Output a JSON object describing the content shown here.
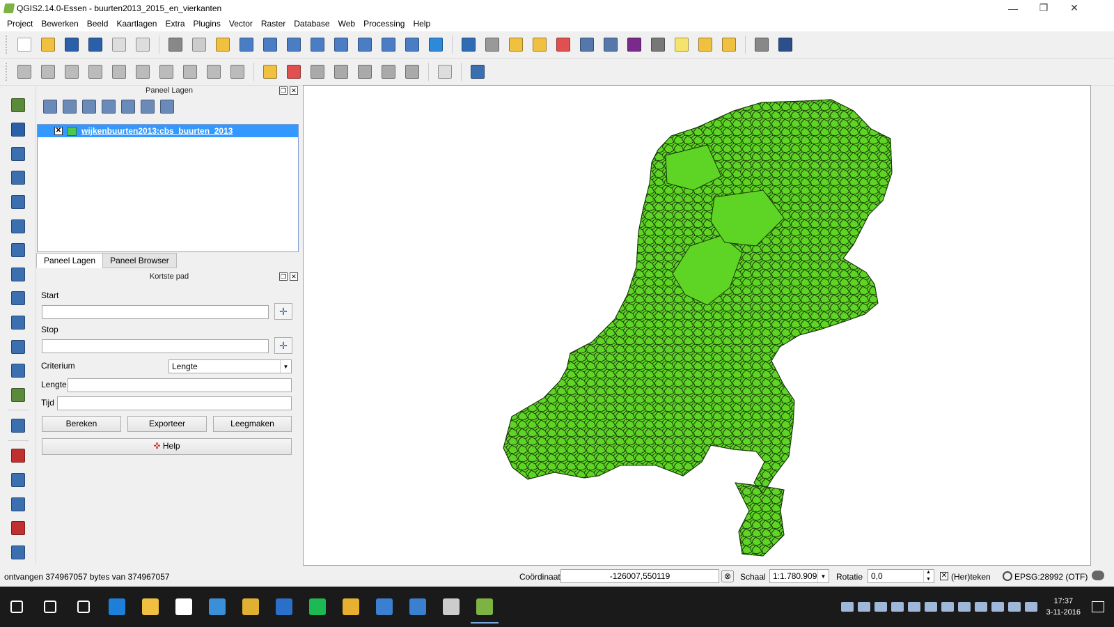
{
  "window": {
    "title": "QGIS2.14.0-Essen - buurten2013_2015_en_vierkanten",
    "min": "—",
    "max": "❐",
    "close": "✕"
  },
  "menu": [
    "Project",
    "Bewerken",
    "Beeld",
    "Kaartlagen",
    "Extra",
    "Plugins",
    "Vector",
    "Raster",
    "Database",
    "Web",
    "Processing",
    "Help"
  ],
  "toolbar1": [
    {
      "icon": "new-project-icon",
      "color": "#ffffff"
    },
    {
      "icon": "open-project-icon",
      "color": "#f0c040"
    },
    {
      "icon": "save-project-icon",
      "color": "#2b5fa8"
    },
    {
      "icon": "save-as-icon",
      "color": "#2b5fa8"
    },
    {
      "icon": "new-print-composer-icon",
      "color": "#dddddd"
    },
    {
      "icon": "composer-manager-icon",
      "color": "#dddddd"
    },
    {
      "icon": "touch-zoom-icon",
      "color": "#888888"
    },
    {
      "icon": "pan-hand-icon",
      "color": "#cccccc"
    },
    {
      "icon": "pan-to-selection-icon",
      "color": "#f0c040"
    },
    {
      "icon": "zoom-in-icon",
      "color": "#4a7dc4"
    },
    {
      "icon": "zoom-out-icon",
      "color": "#4a7dc4"
    },
    {
      "icon": "zoom-native-icon",
      "color": "#4a7dc4"
    },
    {
      "icon": "zoom-full-icon",
      "color": "#4a7dc4"
    },
    {
      "icon": "zoom-selection-icon",
      "color": "#4a7dc4"
    },
    {
      "icon": "zoom-layer-icon",
      "color": "#4a7dc4"
    },
    {
      "icon": "zoom-last-icon",
      "color": "#4a7dc4"
    },
    {
      "icon": "zoom-next-icon",
      "color": "#4a7dc4"
    },
    {
      "icon": "refresh-icon",
      "color": "#2e8ad8"
    },
    {
      "icon": "identify-icon",
      "color": "#2e6db4"
    },
    {
      "icon": "run-action-icon",
      "color": "#999999"
    },
    {
      "icon": "select-features-icon",
      "color": "#f0c040"
    },
    {
      "icon": "select-by-expression-icon",
      "color": "#f0c040"
    },
    {
      "icon": "deselect-icon",
      "color": "#e05050"
    },
    {
      "icon": "attribute-table-icon",
      "color": "#5577aa"
    },
    {
      "icon": "statistics-icon",
      "color": "#5577aa"
    },
    {
      "icon": "sigma-icon",
      "color": "#7a2a8a"
    },
    {
      "icon": "measure-icon",
      "color": "#777777"
    },
    {
      "icon": "map-tips-icon",
      "color": "#f5e36b"
    },
    {
      "icon": "new-bookmark-icon",
      "color": "#f0c040"
    },
    {
      "icon": "show-bookmarks-icon",
      "color": "#f0c040"
    },
    {
      "icon": "text-annotation-icon",
      "color": "#888888"
    },
    {
      "icon": "help-icon",
      "color": "#2b4f8a"
    }
  ],
  "toolbar2": [
    {
      "icon": "current-edits-icon",
      "color": "#bbbbbb"
    },
    {
      "icon": "toggle-editing-icon",
      "color": "#bbbbbb"
    },
    {
      "icon": "save-edits-icon",
      "color": "#bbbbbb"
    },
    {
      "icon": "add-feature-icon",
      "color": "#bbbbbb"
    },
    {
      "icon": "move-feature-icon",
      "color": "#bbbbbb"
    },
    {
      "icon": "node-tool-icon",
      "color": "#bbbbbb"
    },
    {
      "icon": "delete-selected-icon",
      "color": "#bbbbbb"
    },
    {
      "icon": "cut-icon",
      "color": "#bbbbbb"
    },
    {
      "icon": "copy-icon",
      "color": "#bbbbbb"
    },
    {
      "icon": "paste-icon",
      "color": "#bbbbbb"
    },
    {
      "icon": "label-abc-icon",
      "color": "#f0c040"
    },
    {
      "icon": "label-highlight-icon",
      "color": "#e05050"
    },
    {
      "icon": "label-pin-icon",
      "color": "#aaaaaa"
    },
    {
      "icon": "label-show-hide-icon",
      "color": "#aaaaaa"
    },
    {
      "icon": "label-move-icon",
      "color": "#aaaaaa"
    },
    {
      "icon": "label-rotate-icon",
      "color": "#aaaaaa"
    },
    {
      "icon": "label-change-icon",
      "color": "#aaaaaa"
    },
    {
      "icon": "csw-icon",
      "color": "#dddddd"
    },
    {
      "icon": "python-icon",
      "color": "#3a6fb0"
    }
  ],
  "lefttoolbar": [
    {
      "icon": "add-vector-layer-icon",
      "color": "#5b8a3a"
    },
    {
      "icon": "add-raster-layer-icon",
      "color": "#2b5fa8"
    },
    {
      "icon": "add-postgis-layer-icon",
      "color": "#3b6fb0"
    },
    {
      "icon": "add-spatialite-layer-icon",
      "color": "#3b6fb0"
    },
    {
      "icon": "add-mssql-layer-icon",
      "color": "#3b6fb0"
    },
    {
      "icon": "add-db2-layer-icon",
      "color": "#3b6fb0"
    },
    {
      "icon": "add-oracle-layer-icon",
      "color": "#3b6fb0"
    },
    {
      "icon": "add-wms-layer-icon",
      "color": "#3b6fb0"
    },
    {
      "icon": "add-wcs-layer-icon",
      "color": "#3b6fb0"
    },
    {
      "icon": "add-wfs-layer-icon",
      "color": "#3b6fb0"
    },
    {
      "icon": "add-delimited-text-icon",
      "color": "#3b6fb0"
    },
    {
      "icon": "add-virtual-layer-icon",
      "color": "#3b6fb0"
    },
    {
      "icon": "new-shapefile-icon",
      "color": "#5b8a3a"
    },
    {
      "icon": "new-spatialite-icon",
      "color": "#3b6fb0"
    },
    {
      "icon": "coordinate-capture-icon",
      "color": "#c03030"
    },
    {
      "icon": "georeferencer-icon",
      "color": "#3b6fb0"
    },
    {
      "icon": "gps-tools-icon",
      "color": "#3b6fb0"
    },
    {
      "icon": "topology-checker-icon",
      "color": "#c03030"
    },
    {
      "icon": "road-graph-icon",
      "color": "#3b6fb0"
    }
  ],
  "layers_panel": {
    "title": "Paneel Lagen",
    "tools": [
      {
        "icon": "add-group-icon"
      },
      {
        "icon": "manage-visibility-icon"
      },
      {
        "icon": "filter-legend-icon"
      },
      {
        "icon": "filter-expression-icon"
      },
      {
        "icon": "expand-all-icon"
      },
      {
        "icon": "collapse-all-icon"
      },
      {
        "icon": "remove-layer-icon"
      }
    ],
    "layer": {
      "name": "wijkenbuurten2013:cbs_buurten_2013",
      "checked": "✕",
      "fill": "#4cc84c"
    }
  },
  "tabs": [
    "Paneel Lagen",
    "Paneel Browser"
  ],
  "shortest_path": {
    "title": "Kortste pad",
    "start_label": "Start",
    "start_value": "",
    "stop_label": "Stop",
    "stop_value": "",
    "criterion_label": "Criterium",
    "criterion_value": "Lengte",
    "length_label": "Lengte",
    "length_value": "",
    "time_label": "Tijd",
    "time_value": "",
    "calc": "Bereken",
    "export": "Exporteer",
    "clear": "Leegmaken",
    "help": "Help"
  },
  "map": {
    "fill": "#5ed425",
    "stroke": "#1a3a0a",
    "background": "#ffffff"
  },
  "status": {
    "message": "ontvangen 374967057 bytes van 374967057",
    "coord_label": "Coördinaat",
    "coord_value": "-126007,550119",
    "scale_label": "Schaal",
    "scale_value": "1:1.780.909",
    "rotation_label": "Rotatie",
    "rotation_value": "0,0",
    "render_label": "(Her)teken",
    "render_checked": "✕",
    "crs": "EPSG:28992 (OTF)"
  },
  "taskbar": {
    "apps": [
      {
        "icon": "windows-start-icon",
        "color": "#ffffff"
      },
      {
        "icon": "search-icon",
        "color": "#ffffff"
      },
      {
        "icon": "task-view-icon",
        "color": "#ffffff"
      },
      {
        "icon": "edge-icon",
        "color": "#1e7fd8"
      },
      {
        "icon": "file-explorer-icon",
        "color": "#f0c040"
      },
      {
        "icon": "store-icon",
        "color": "#ffffff"
      },
      {
        "icon": "search-app-icon",
        "color": "#3a8fd8"
      },
      {
        "icon": "archive-icon",
        "color": "#e0b030"
      },
      {
        "icon": "outlook-icon",
        "color": "#2a6fc8"
      },
      {
        "icon": "spotify-icon",
        "color": "#1db954"
      },
      {
        "icon": "chrome-icon",
        "color": "#e8b030"
      },
      {
        "icon": "remote-desktop-icon",
        "color": "#3a7fd0"
      },
      {
        "icon": "network-icon",
        "color": "#3a7fd0"
      },
      {
        "icon": "paint-icon",
        "color": "#cccccc"
      },
      {
        "icon": "qgis-icon",
        "color": "#7cb342"
      }
    ],
    "time": "17:37",
    "date": "3-11-2016"
  }
}
